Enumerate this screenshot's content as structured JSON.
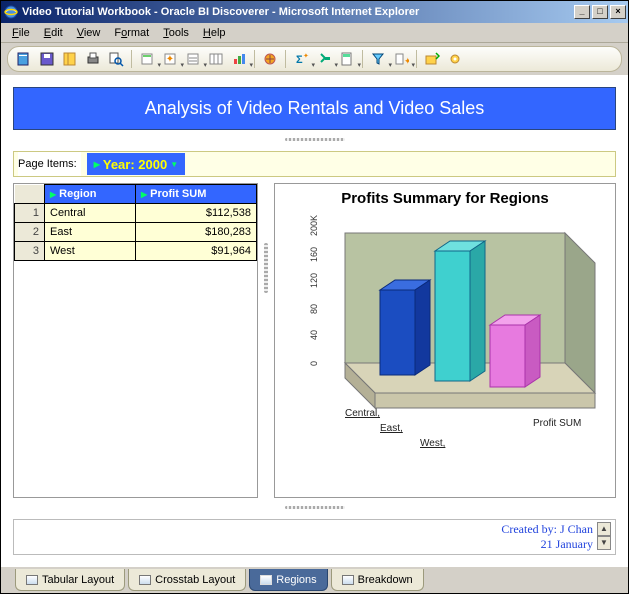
{
  "window": {
    "title": "Video Tutorial Workbook - Oracle BI  Discoverer - Microsoft Internet Explorer",
    "minimize": "_",
    "maximize": "□",
    "close": "×"
  },
  "menu": {
    "file": "File",
    "edit": "Edit",
    "view": "View",
    "format": "Format",
    "tools": "Tools",
    "help": "Help"
  },
  "banner": {
    "title": "Analysis of Video Rentals and Video Sales"
  },
  "page_items": {
    "label": "Page Items:",
    "year_label": "Year:",
    "year_value": "2000"
  },
  "table": {
    "columns": {
      "region": "Region",
      "profit": "Profit SUM"
    },
    "rows": [
      {
        "idx": "1",
        "region": "Central",
        "profit": "$112,538"
      },
      {
        "idx": "2",
        "region": "East",
        "profit": "$180,283"
      },
      {
        "idx": "3",
        "region": "West",
        "profit": "$91,964"
      }
    ]
  },
  "chart_data": {
    "type": "bar",
    "title": "Profits Summary for Regions",
    "categories": [
      "Central,",
      "East,",
      "West,"
    ],
    "values": [
      112538,
      180283,
      91964
    ],
    "series_label": "Profit SUM",
    "y_ticks": [
      "0",
      "40",
      "80",
      "120",
      "160",
      "200K"
    ],
    "ylim": [
      0,
      200000
    ]
  },
  "footnote": {
    "created_by": "Created by: J Chan",
    "date": "21 January"
  },
  "tabs": {
    "tabular": "Tabular Layout",
    "crosstab": "Crosstab Layout",
    "regions": "Regions",
    "breakdown": "Breakdown"
  },
  "colors": {
    "bar1": "#1b4dc1",
    "bar2": "#3fd0cf",
    "bar3": "#e77adf",
    "floor": "#d8d4b8",
    "wall": "#b8c3a2"
  }
}
